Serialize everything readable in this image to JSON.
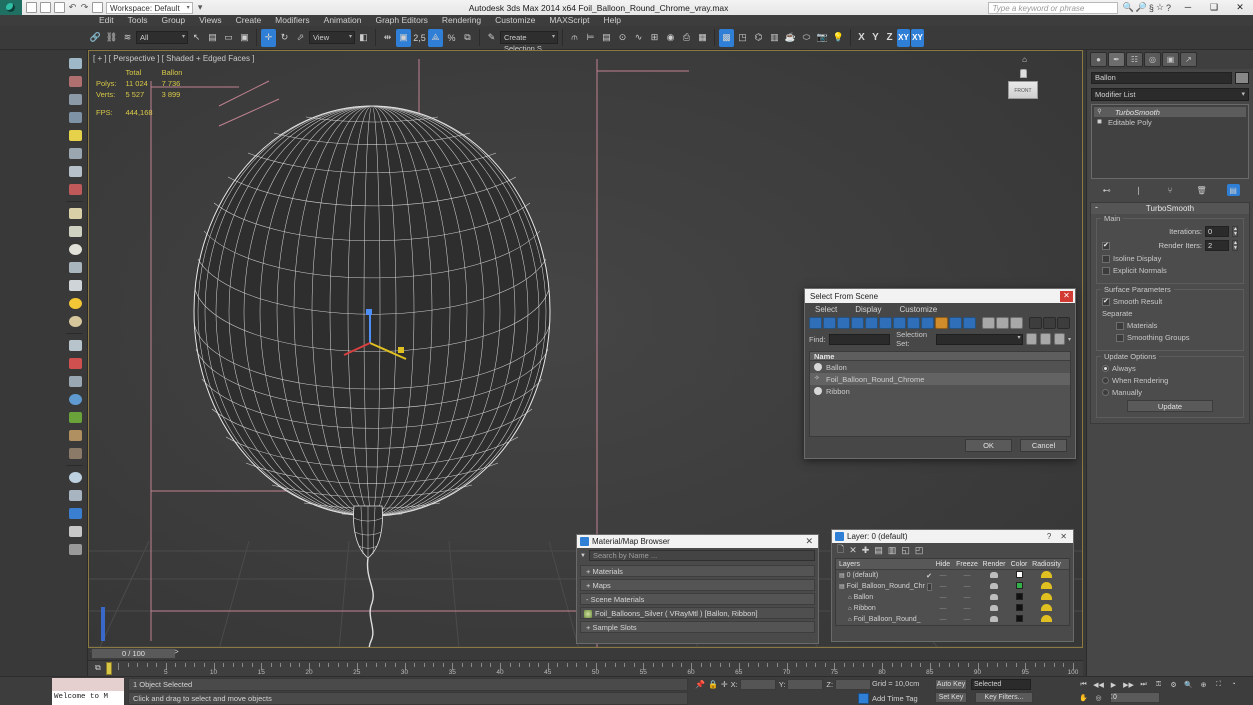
{
  "titlebar": {
    "workspace_label": "Workspace: Default",
    "app_title": "Autodesk 3ds Max  2014 x64    Foil_Balloon_Round_Chrome_vray.max",
    "search_placeholder": "Type a keyword or phrase",
    "min_label": "─",
    "max_label": "❑",
    "close_label": "✕"
  },
  "menubar": {
    "items": [
      {
        "label": "Edit"
      },
      {
        "label": "Tools"
      },
      {
        "label": "Group"
      },
      {
        "label": "Views"
      },
      {
        "label": "Create"
      },
      {
        "label": "Modifiers"
      },
      {
        "label": "Animation"
      },
      {
        "label": "Graph Editors"
      },
      {
        "label": "Rendering"
      },
      {
        "label": "Customize"
      },
      {
        "label": "MAXScript"
      },
      {
        "label": "Help"
      }
    ]
  },
  "toolbar": {
    "selection_filter": "All",
    "reference_coord": "View",
    "named_selection_set": "Create Selection S",
    "angle_snap_value": "2,5",
    "axis_x": "X",
    "axis_y": "Y",
    "axis_z": "Z",
    "axis_xy": "XY",
    "axis_xy2": "XY"
  },
  "viewport": {
    "label": "[ + ] [ Perspective ] [ Shaded + Edged Faces ]",
    "stats": {
      "col_total": "Total",
      "col_object": "Ballon",
      "polys_label": "Polys:",
      "polys_total": "11 024",
      "polys_object": "7 736",
      "verts_label": "Verts:",
      "verts_total": "5 527",
      "verts_object": "3 899",
      "fps_label": "FPS:",
      "fps_value": "444,168"
    },
    "viewcube_face": "FRONT"
  },
  "command_panel": {
    "tabs": [
      {
        "name": "create",
        "glyph": "●"
      },
      {
        "name": "modify",
        "glyph": "✒"
      },
      {
        "name": "hierarchy",
        "glyph": "☷"
      },
      {
        "name": "motion",
        "glyph": "◎"
      },
      {
        "name": "display",
        "glyph": "▣"
      },
      {
        "name": "utilities",
        "glyph": "↗"
      }
    ],
    "object_name": "Ballon",
    "modifier_list_label": "Modifier List",
    "modifier_stack": [
      {
        "label": "TurboSmooth",
        "selected": true
      },
      {
        "label": "Editable Poly",
        "selected": false
      }
    ],
    "turbosmooth": {
      "title": "TurboSmooth",
      "main_group": "Main",
      "iterations_label": "Iterations:",
      "iterations_value": "0",
      "render_iters_label": "Render Iters:",
      "render_iters_value": "2",
      "render_iters_checked": true,
      "isoline_display": "Isoline Display",
      "explicit_normals": "Explicit Normals",
      "surface_params_group": "Surface Parameters",
      "smooth_result": "Smooth Result",
      "separate_label": "Separate",
      "materials": "Materials",
      "smoothing_groups": "Smoothing Groups",
      "update_options_group": "Update Options",
      "always": "Always",
      "when_rendering": "When Rendering",
      "manually": "Manually",
      "update_button": "Update"
    }
  },
  "select_from_scene": {
    "title": "Select From Scene",
    "close_label": "✕",
    "menu": [
      "Select",
      "Display",
      "Customize"
    ],
    "find_label": "Find:",
    "find_value": "",
    "selection_set_label": "Selection Set:",
    "selection_set_value": "",
    "column_header": "Name",
    "rows": [
      {
        "name": "Ballon",
        "icon": "sphere-icon",
        "selected": false
      },
      {
        "name": "Foil_Balloon_Round_Chrome",
        "icon": "shape-icon",
        "selected": true
      },
      {
        "name": "Ribbon",
        "icon": "sphere-icon",
        "selected": false
      }
    ],
    "ok_label": "OK",
    "cancel_label": "Cancel"
  },
  "material_browser": {
    "title": "Material/Map Browser",
    "close_label": "✕",
    "search_placeholder": "Search by Name ...",
    "sections": [
      {
        "label": "+ Materials"
      },
      {
        "label": "+ Maps"
      },
      {
        "label": "- Scene Materials"
      }
    ],
    "scene_material": "Foil_Balloons_Silver ( VRayMtl ) [Ballon, Ribbon]",
    "sample_slots": "+ Sample Slots"
  },
  "layer_panel": {
    "title": "Layer: 0 (default)",
    "help_label": "?",
    "close_label": "✕",
    "columns": [
      "Layers",
      "Hide",
      "Freeze",
      "Render",
      "Color",
      "Radiosity"
    ],
    "rows": [
      {
        "name": "0 (default)",
        "indent": 0,
        "current": true,
        "hide": "—",
        "freeze": "—",
        "color": "#ffffff"
      },
      {
        "name": "Foil_Balloon_Round_Chr",
        "indent": 0,
        "current": false,
        "hide": "—",
        "freeze": "—",
        "color": "#34b04a"
      },
      {
        "name": "Ballon",
        "indent": 1,
        "current": false,
        "hide": "—",
        "freeze": "—",
        "color": "#111111"
      },
      {
        "name": "Ribbon",
        "indent": 1,
        "current": false,
        "hide": "—",
        "freeze": "—",
        "color": "#111111"
      },
      {
        "name": "Foil_Balloon_Round_",
        "indent": 1,
        "current": false,
        "hide": "—",
        "freeze": "—",
        "color": "#111111"
      }
    ]
  },
  "timeline": {
    "current_frame": "0 / 100",
    "prev_label": "<",
    "next_label": ">",
    "ticks": [
      0,
      5,
      10,
      15,
      20,
      25,
      30,
      35,
      40,
      45,
      50,
      55,
      60,
      65,
      70,
      75,
      80,
      85,
      90,
      95,
      100
    ]
  },
  "statusbar": {
    "maxscript_prompt": "Welcome to M",
    "selection_status": "1 Object Selected",
    "prompt": "Click and drag to select and move objects",
    "x_label": "X:",
    "x_value": "",
    "y_label": "Y:",
    "y_value": "",
    "z_label": "Z:",
    "z_value": "",
    "grid_label": "Grid = 10,0cm",
    "add_time_tag": "Add Time Tag",
    "auto_key": "Auto Key",
    "set_key": "Set Key",
    "key_mode": "Selected",
    "key_filters": "Key Filters...",
    "key_number": "0"
  }
}
